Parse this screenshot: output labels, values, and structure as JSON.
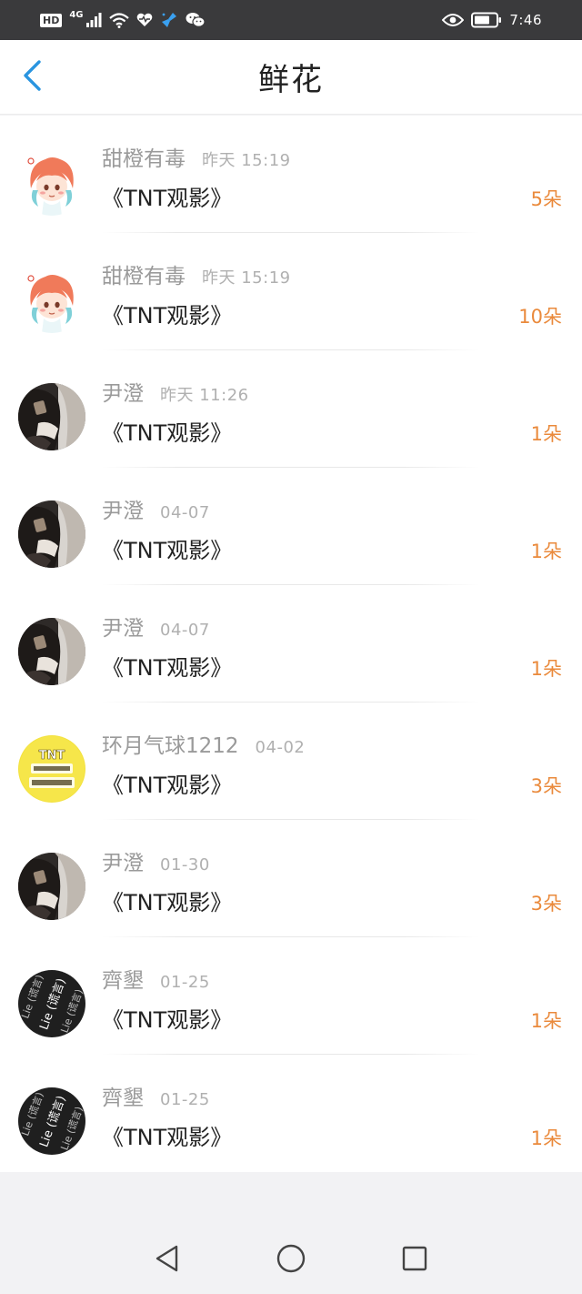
{
  "status_bar": {
    "hd": "HD",
    "network": "4G",
    "time": "7:46",
    "icons": [
      "signal-icon",
      "wifi-icon",
      "health-icon",
      "cleaner-icon",
      "wechat-icon",
      "eye-icon",
      "battery-icon"
    ]
  },
  "header": {
    "title": "鲜花",
    "back_icon": "chevron-left-icon",
    "accent_color": "#2a95e0"
  },
  "colors": {
    "count": "#ea8a3c",
    "name": "#9a9a9a",
    "time": "#b0b0b0"
  },
  "items": [
    {
      "name": "甜橙有毒",
      "time": "昨天 15:19",
      "work": "《TNT观影》",
      "count": "5朵",
      "avatar": "cartoon-girl-avatar"
    },
    {
      "name": "甜橙有毒",
      "time": "昨天 15:19",
      "work": "《TNT观影》",
      "count": "10朵",
      "avatar": "cartoon-girl-avatar"
    },
    {
      "name": "尹澄",
      "time": "昨天 11:26",
      "work": "《TNT观影》",
      "count": "1朵",
      "avatar": "dark-photo-avatar"
    },
    {
      "name": "尹澄",
      "time": "04-07",
      "work": "《TNT观影》",
      "count": "1朵",
      "avatar": "dark-photo-avatar"
    },
    {
      "name": "尹澄",
      "time": "04-07",
      "work": "《TNT观影》",
      "count": "1朵",
      "avatar": "dark-photo-avatar"
    },
    {
      "name": "环月气球1212",
      "time": "04-02",
      "work": "《TNT观影》",
      "count": "3朵",
      "avatar": "tnt-yellow-avatar",
      "avatar_text": "TNT"
    },
    {
      "name": "尹澄",
      "time": "01-30",
      "work": "《TNT观影》",
      "count": "3朵",
      "avatar": "dark-photo-avatar"
    },
    {
      "name": "齊墾",
      "time": "01-25",
      "work": "《TNT观影》",
      "count": "1朵",
      "avatar": "lie-black-avatar",
      "avatar_text": "Lie (谎言)"
    },
    {
      "name": "齊墾",
      "time": "01-25",
      "work": "《TNT观影》",
      "count": "1朵",
      "avatar": "lie-black-avatar",
      "avatar_text": "Lie (谎言)"
    }
  ],
  "nav_bar": {
    "buttons": [
      "back-triangle-icon",
      "home-circle-icon",
      "recents-square-icon"
    ]
  }
}
